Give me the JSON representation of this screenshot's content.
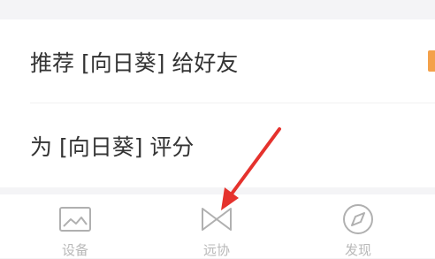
{
  "menu": {
    "items": [
      {
        "label": "推荐 [向日葵] 给好友"
      },
      {
        "label": "为 [向日葵] 评分"
      }
    ]
  },
  "tabbar": {
    "tabs": [
      {
        "label": "设备",
        "icon": "image-frame-icon"
      },
      {
        "label": "远协",
        "icon": "remote-assist-icon"
      },
      {
        "label": "发现",
        "icon": "compass-icon"
      }
    ]
  },
  "colors": {
    "annotation_arrow": "#e5322d",
    "accent": "#f4a14a",
    "tab_inactive": "#b9b9b9"
  }
}
